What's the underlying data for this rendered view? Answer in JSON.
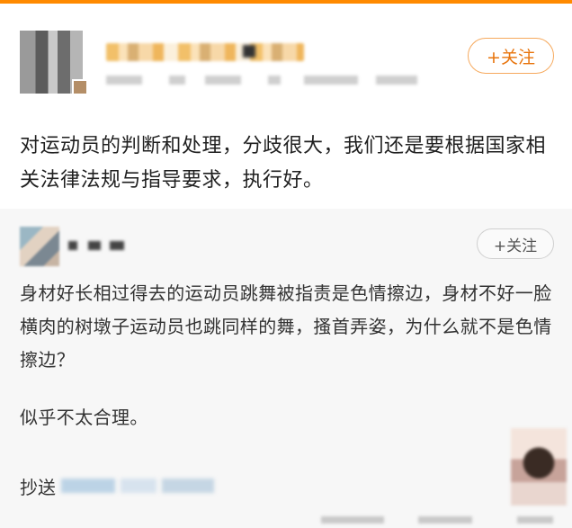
{
  "post": {
    "follow_label": "+关注",
    "text": "对运动员的判断和处理，分歧很大，我们还是要根据国家相关法律法规与指导要求，执行好。"
  },
  "quote": {
    "follow_label": "+关注",
    "paragraph1": "身材好长相过得去的运动员跳舞被指责是色情擦边，身材不好一脸横肉的树墩子运动员也跳同样的舞，搔首弄姿，为什么就不是色情擦边？",
    "paragraph2": "似乎不太合理。",
    "cc_label": "抄送"
  },
  "colors": {
    "accent": "#ff8a00",
    "follow_text": "#e8740c",
    "follow_border": "#f6a95d",
    "quote_bg": "#f7f7f7"
  },
  "icons": {
    "avatar_main": "user-avatar-blurred",
    "avatar_quote": "user-avatar-blurred",
    "thumbnail": "image-thumbnail-blurred"
  }
}
